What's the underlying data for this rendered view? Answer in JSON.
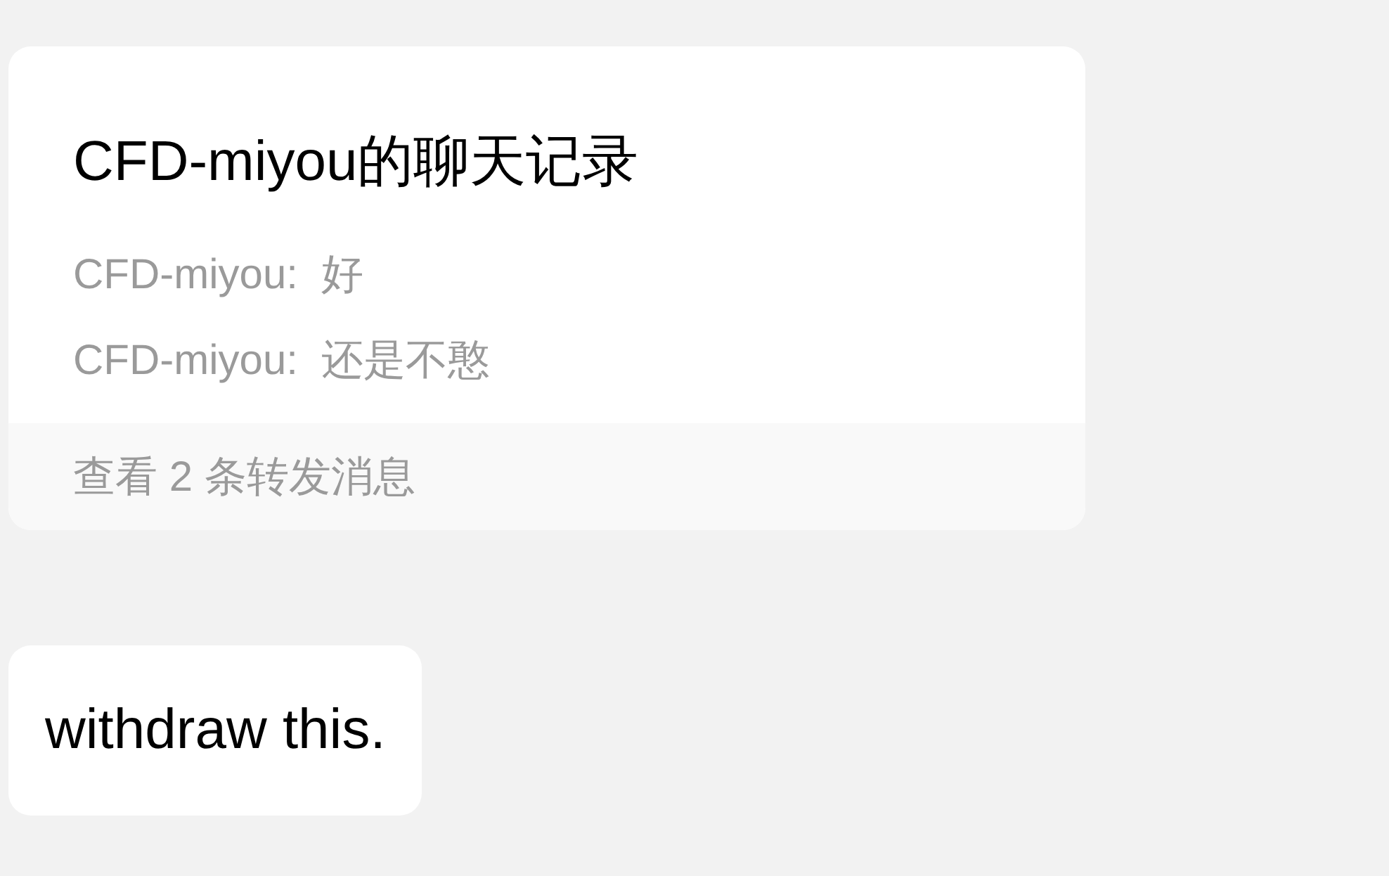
{
  "forwarded_card": {
    "title": "CFD-miyou的聊天记录",
    "lines": [
      {
        "sender": "CFD-miyou:",
        "text": "好"
      },
      {
        "sender": "CFD-miyou:",
        "text": "还是不憨"
      }
    ],
    "footer": "查看 2 条转发消息"
  },
  "message": {
    "text": "withdraw this."
  }
}
